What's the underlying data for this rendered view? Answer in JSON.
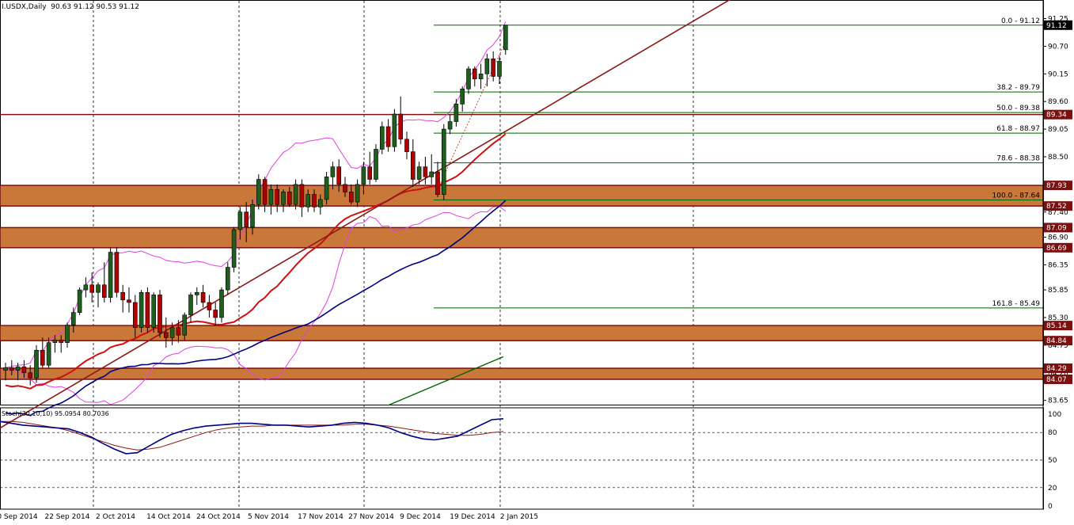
{
  "header": {
    "symbol": "I.USDX,Daily",
    "ohlc": "90.63 91.12 90.53 91.12"
  },
  "colors": {
    "bull": "#1f5e1f",
    "bear": "#b00000",
    "zone_fill": "#c9783a",
    "zone_border": "#7a1010",
    "bollinger": "#e040e0",
    "ma_red": "#d01010",
    "ma_navy": "#000080",
    "fib": "#006400",
    "trend": "#8b1a1a",
    "label_bg": "#000000",
    "label_red_bg": "#7a1010"
  },
  "chart_data": [
    {
      "type": "candlestick",
      "symbol": "I.USDX",
      "timeframe": "Daily",
      "last": 91.12,
      "ylim": [
        83.55,
        91.4
      ],
      "y_ticks": [
        91.25,
        90.7,
        90.15,
        89.6,
        89.05,
        88.5,
        87.95,
        87.4,
        86.9,
        86.35,
        85.85,
        85.3,
        84.75,
        84.2,
        83.65
      ],
      "x_ticks": [
        "10 Sep 2014",
        "22 Sep 2014",
        "2 Oct 2014",
        "14 Oct 2014",
        "24 Oct 2014",
        "5 Nov 2014",
        "17 Nov 2014",
        "27 Nov 2014",
        "9 Dec 2014",
        "19 Dec 2014",
        "2 Jan 2015"
      ],
      "x_tick_labels_shown": [
        "0 Sep 2014",
        "22 Sep 2014",
        "2 Oct 2014",
        "14 Oct 2014",
        "24 Oct 2014",
        "5 Nov 2014",
        "17 Nov 2014",
        "27 Nov 2014",
        "9 Dec 2014",
        "19 Dec 2014",
        "2 Jan 2015"
      ],
      "candles": [
        {
          "o": 84.25,
          "h": 84.4,
          "l": 84.05,
          "c": 84.3
        },
        {
          "o": 84.3,
          "h": 84.45,
          "l": 84.15,
          "c": 84.25
        },
        {
          "o": 84.25,
          "h": 84.4,
          "l": 84.05,
          "c": 84.32
        },
        {
          "o": 84.32,
          "h": 84.45,
          "l": 84.1,
          "c": 84.2
        },
        {
          "o": 84.2,
          "h": 84.35,
          "l": 83.95,
          "c": 84.1
        },
        {
          "o": 84.1,
          "h": 84.75,
          "l": 84.0,
          "c": 84.65
        },
        {
          "o": 84.65,
          "h": 84.9,
          "l": 84.3,
          "c": 84.35
        },
        {
          "o": 84.35,
          "h": 84.9,
          "l": 84.3,
          "c": 84.8
        },
        {
          "o": 84.8,
          "h": 84.95,
          "l": 84.6,
          "c": 84.85
        },
        {
          "o": 84.85,
          "h": 84.95,
          "l": 84.6,
          "c": 84.8
        },
        {
          "o": 84.8,
          "h": 85.2,
          "l": 84.7,
          "c": 85.15
        },
        {
          "o": 85.15,
          "h": 85.5,
          "l": 85.0,
          "c": 85.4
        },
        {
          "o": 85.4,
          "h": 85.9,
          "l": 85.35,
          "c": 85.85
        },
        {
          "o": 85.85,
          "h": 86.1,
          "l": 85.7,
          "c": 85.95
        },
        {
          "o": 85.95,
          "h": 86.2,
          "l": 85.6,
          "c": 85.8
        },
        {
          "o": 85.8,
          "h": 86.0,
          "l": 85.5,
          "c": 85.95
        },
        {
          "o": 85.95,
          "h": 86.4,
          "l": 85.6,
          "c": 85.7
        },
        {
          "o": 85.7,
          "h": 86.7,
          "l": 85.6,
          "c": 86.6
        },
        {
          "o": 86.6,
          "h": 86.7,
          "l": 85.7,
          "c": 85.8
        },
        {
          "o": 85.8,
          "h": 85.95,
          "l": 85.4,
          "c": 85.65
        },
        {
          "o": 85.65,
          "h": 85.9,
          "l": 85.4,
          "c": 85.6
        },
        {
          "o": 85.6,
          "h": 85.75,
          "l": 84.9,
          "c": 85.1
        },
        {
          "o": 85.1,
          "h": 85.85,
          "l": 85.0,
          "c": 85.8
        },
        {
          "o": 85.8,
          "h": 85.9,
          "l": 85.0,
          "c": 85.1
        },
        {
          "o": 85.1,
          "h": 85.8,
          "l": 85.0,
          "c": 85.75
        },
        {
          "o": 85.75,
          "h": 85.85,
          "l": 84.9,
          "c": 85.0
        },
        {
          "o": 85.0,
          "h": 85.3,
          "l": 84.7,
          "c": 84.9
        },
        {
          "o": 84.9,
          "h": 85.2,
          "l": 84.75,
          "c": 85.1
        },
        {
          "o": 85.1,
          "h": 85.25,
          "l": 84.8,
          "c": 84.95
        },
        {
          "o": 84.95,
          "h": 85.4,
          "l": 84.85,
          "c": 85.35
        },
        {
          "o": 85.35,
          "h": 85.8,
          "l": 85.2,
          "c": 85.75
        },
        {
          "o": 85.75,
          "h": 85.9,
          "l": 85.55,
          "c": 85.8
        },
        {
          "o": 85.8,
          "h": 85.95,
          "l": 85.5,
          "c": 85.6
        },
        {
          "o": 85.6,
          "h": 85.75,
          "l": 85.3,
          "c": 85.45
        },
        {
          "o": 85.45,
          "h": 85.6,
          "l": 85.15,
          "c": 85.3
        },
        {
          "o": 85.3,
          "h": 85.9,
          "l": 85.2,
          "c": 85.85
        },
        {
          "o": 85.85,
          "h": 86.4,
          "l": 85.75,
          "c": 86.3
        },
        {
          "o": 86.3,
          "h": 87.1,
          "l": 86.2,
          "c": 87.05
        },
        {
          "o": 87.05,
          "h": 87.5,
          "l": 86.85,
          "c": 87.4
        },
        {
          "o": 87.4,
          "h": 87.6,
          "l": 86.8,
          "c": 87.1
        },
        {
          "o": 87.1,
          "h": 87.65,
          "l": 86.95,
          "c": 87.55
        },
        {
          "o": 87.55,
          "h": 88.15,
          "l": 87.45,
          "c": 88.05
        },
        {
          "o": 88.05,
          "h": 88.1,
          "l": 87.4,
          "c": 87.55
        },
        {
          "o": 87.55,
          "h": 87.95,
          "l": 87.35,
          "c": 87.85
        },
        {
          "o": 87.85,
          "h": 87.95,
          "l": 87.4,
          "c": 87.55
        },
        {
          "o": 87.55,
          "h": 87.85,
          "l": 87.4,
          "c": 87.8
        },
        {
          "o": 87.8,
          "h": 87.9,
          "l": 87.5,
          "c": 87.55
        },
        {
          "o": 87.55,
          "h": 88.05,
          "l": 87.45,
          "c": 87.95
        },
        {
          "o": 87.95,
          "h": 88.05,
          "l": 87.3,
          "c": 87.5
        },
        {
          "o": 87.5,
          "h": 87.85,
          "l": 87.4,
          "c": 87.75
        },
        {
          "o": 87.75,
          "h": 87.85,
          "l": 87.4,
          "c": 87.5
        },
        {
          "o": 87.5,
          "h": 87.75,
          "l": 87.35,
          "c": 87.65
        },
        {
          "o": 87.65,
          "h": 88.2,
          "l": 87.55,
          "c": 88.1
        },
        {
          "o": 88.1,
          "h": 88.4,
          "l": 87.85,
          "c": 88.3
        },
        {
          "o": 88.3,
          "h": 88.45,
          "l": 87.8,
          "c": 87.95
        },
        {
          "o": 87.95,
          "h": 88.1,
          "l": 87.7,
          "c": 87.8
        },
        {
          "o": 87.8,
          "h": 87.95,
          "l": 87.55,
          "c": 87.6
        },
        {
          "o": 87.6,
          "h": 88.05,
          "l": 87.5,
          "c": 87.95
        },
        {
          "o": 87.95,
          "h": 88.4,
          "l": 87.75,
          "c": 88.3
        },
        {
          "o": 88.3,
          "h": 88.6,
          "l": 87.95,
          "c": 88.05
        },
        {
          "o": 88.05,
          "h": 88.75,
          "l": 88.0,
          "c": 88.65
        },
        {
          "o": 88.65,
          "h": 89.2,
          "l": 88.55,
          "c": 89.1
        },
        {
          "o": 89.1,
          "h": 89.25,
          "l": 88.6,
          "c": 88.7
        },
        {
          "o": 88.7,
          "h": 89.45,
          "l": 88.6,
          "c": 89.35
        },
        {
          "o": 89.35,
          "h": 89.7,
          "l": 88.75,
          "c": 88.85
        },
        {
          "o": 88.85,
          "h": 89.0,
          "l": 88.45,
          "c": 88.6
        },
        {
          "o": 88.6,
          "h": 88.85,
          "l": 87.9,
          "c": 88.05
        },
        {
          "o": 88.05,
          "h": 88.4,
          "l": 87.95,
          "c": 88.3
        },
        {
          "o": 88.3,
          "h": 88.5,
          "l": 87.95,
          "c": 88.1
        },
        {
          "o": 88.1,
          "h": 88.55,
          "l": 87.95,
          "c": 88.2
        },
        {
          "o": 88.2,
          "h": 88.4,
          "l": 87.7,
          "c": 87.75
        },
        {
          "o": 87.75,
          "h": 89.15,
          "l": 87.64,
          "c": 89.05
        },
        {
          "o": 89.05,
          "h": 89.35,
          "l": 88.95,
          "c": 89.2
        },
        {
          "o": 89.2,
          "h": 89.65,
          "l": 89.1,
          "c": 89.55
        },
        {
          "o": 89.55,
          "h": 89.9,
          "l": 89.4,
          "c": 89.85
        },
        {
          "o": 89.85,
          "h": 90.3,
          "l": 89.75,
          "c": 90.25
        },
        {
          "o": 90.25,
          "h": 90.3,
          "l": 89.9,
          "c": 90.05
        },
        {
          "o": 90.05,
          "h": 90.35,
          "l": 89.85,
          "c": 90.15
        },
        {
          "o": 90.15,
          "h": 90.55,
          "l": 89.9,
          "c": 90.45
        },
        {
          "o": 90.45,
          "h": 90.6,
          "l": 90.0,
          "c": 90.1
        },
        {
          "o": 90.1,
          "h": 90.5,
          "l": 89.95,
          "c": 90.4
        },
        {
          "o": 90.63,
          "h": 91.12,
          "l": 90.53,
          "c": 91.12
        }
      ],
      "horizontal_levels": [
        {
          "value": 89.34,
          "label": "89.34",
          "style": "red-line"
        },
        {
          "value": 90.7,
          "label": "90.70",
          "style": "tick"
        },
        {
          "value": 86.9,
          "label": "86.90",
          "style": "tick"
        }
      ],
      "zones": [
        {
          "top": 87.93,
          "bottom": 87.52
        },
        {
          "top": 87.09,
          "bottom": 86.69
        },
        {
          "top": 85.14,
          "bottom": 84.84
        },
        {
          "top": 84.29,
          "bottom": 84.07
        }
      ],
      "right_labels": [
        "91.12",
        "89.34",
        "87.93",
        "87.52",
        "87.09",
        "86.69",
        "85.14",
        "84.84",
        "84.29",
        "84.07"
      ],
      "fibonacci": [
        {
          "text": "0.0 - 91.12",
          "value": 91.12
        },
        {
          "text": "38.2 - 89.79",
          "value": 89.79
        },
        {
          "text": "50.0 - 89.38",
          "value": 89.38
        },
        {
          "text": "61.8 - 88.97",
          "value": 88.97
        },
        {
          "text": "78.6 - 88.38",
          "value": 88.38
        },
        {
          "text": "100.0 - 87.64",
          "value": 87.64
        },
        {
          "text": "161.8 - 85.49",
          "value": 85.49
        }
      ]
    },
    {
      "type": "line",
      "name": "Stoch",
      "legend": "Stoch(30,10,10) 95.0954 80.7036",
      "ylim": [
        0,
        100
      ],
      "y_ticks": [
        100,
        80,
        50,
        20,
        0
      ],
      "main": [
        92,
        90,
        88,
        87,
        86,
        85,
        84,
        80,
        75,
        68,
        62,
        57,
        58,
        65,
        72,
        78,
        82,
        85,
        87,
        88,
        89,
        90,
        90,
        89,
        88,
        88,
        87,
        86,
        87,
        88,
        90,
        91,
        90,
        88,
        85,
        80,
        76,
        73,
        72,
        74,
        76,
        82,
        88,
        94,
        95
      ],
      "signal": [
        92,
        92,
        91,
        89,
        87,
        85,
        82,
        78,
        74,
        70,
        66,
        63,
        61,
        62,
        64,
        68,
        72,
        76,
        80,
        83,
        85,
        86,
        87,
        87,
        88,
        88,
        88,
        88,
        88,
        88,
        88,
        89,
        89,
        88,
        87,
        85,
        83,
        81,
        79,
        78,
        77,
        77,
        78,
        80,
        81
      ]
    }
  ]
}
